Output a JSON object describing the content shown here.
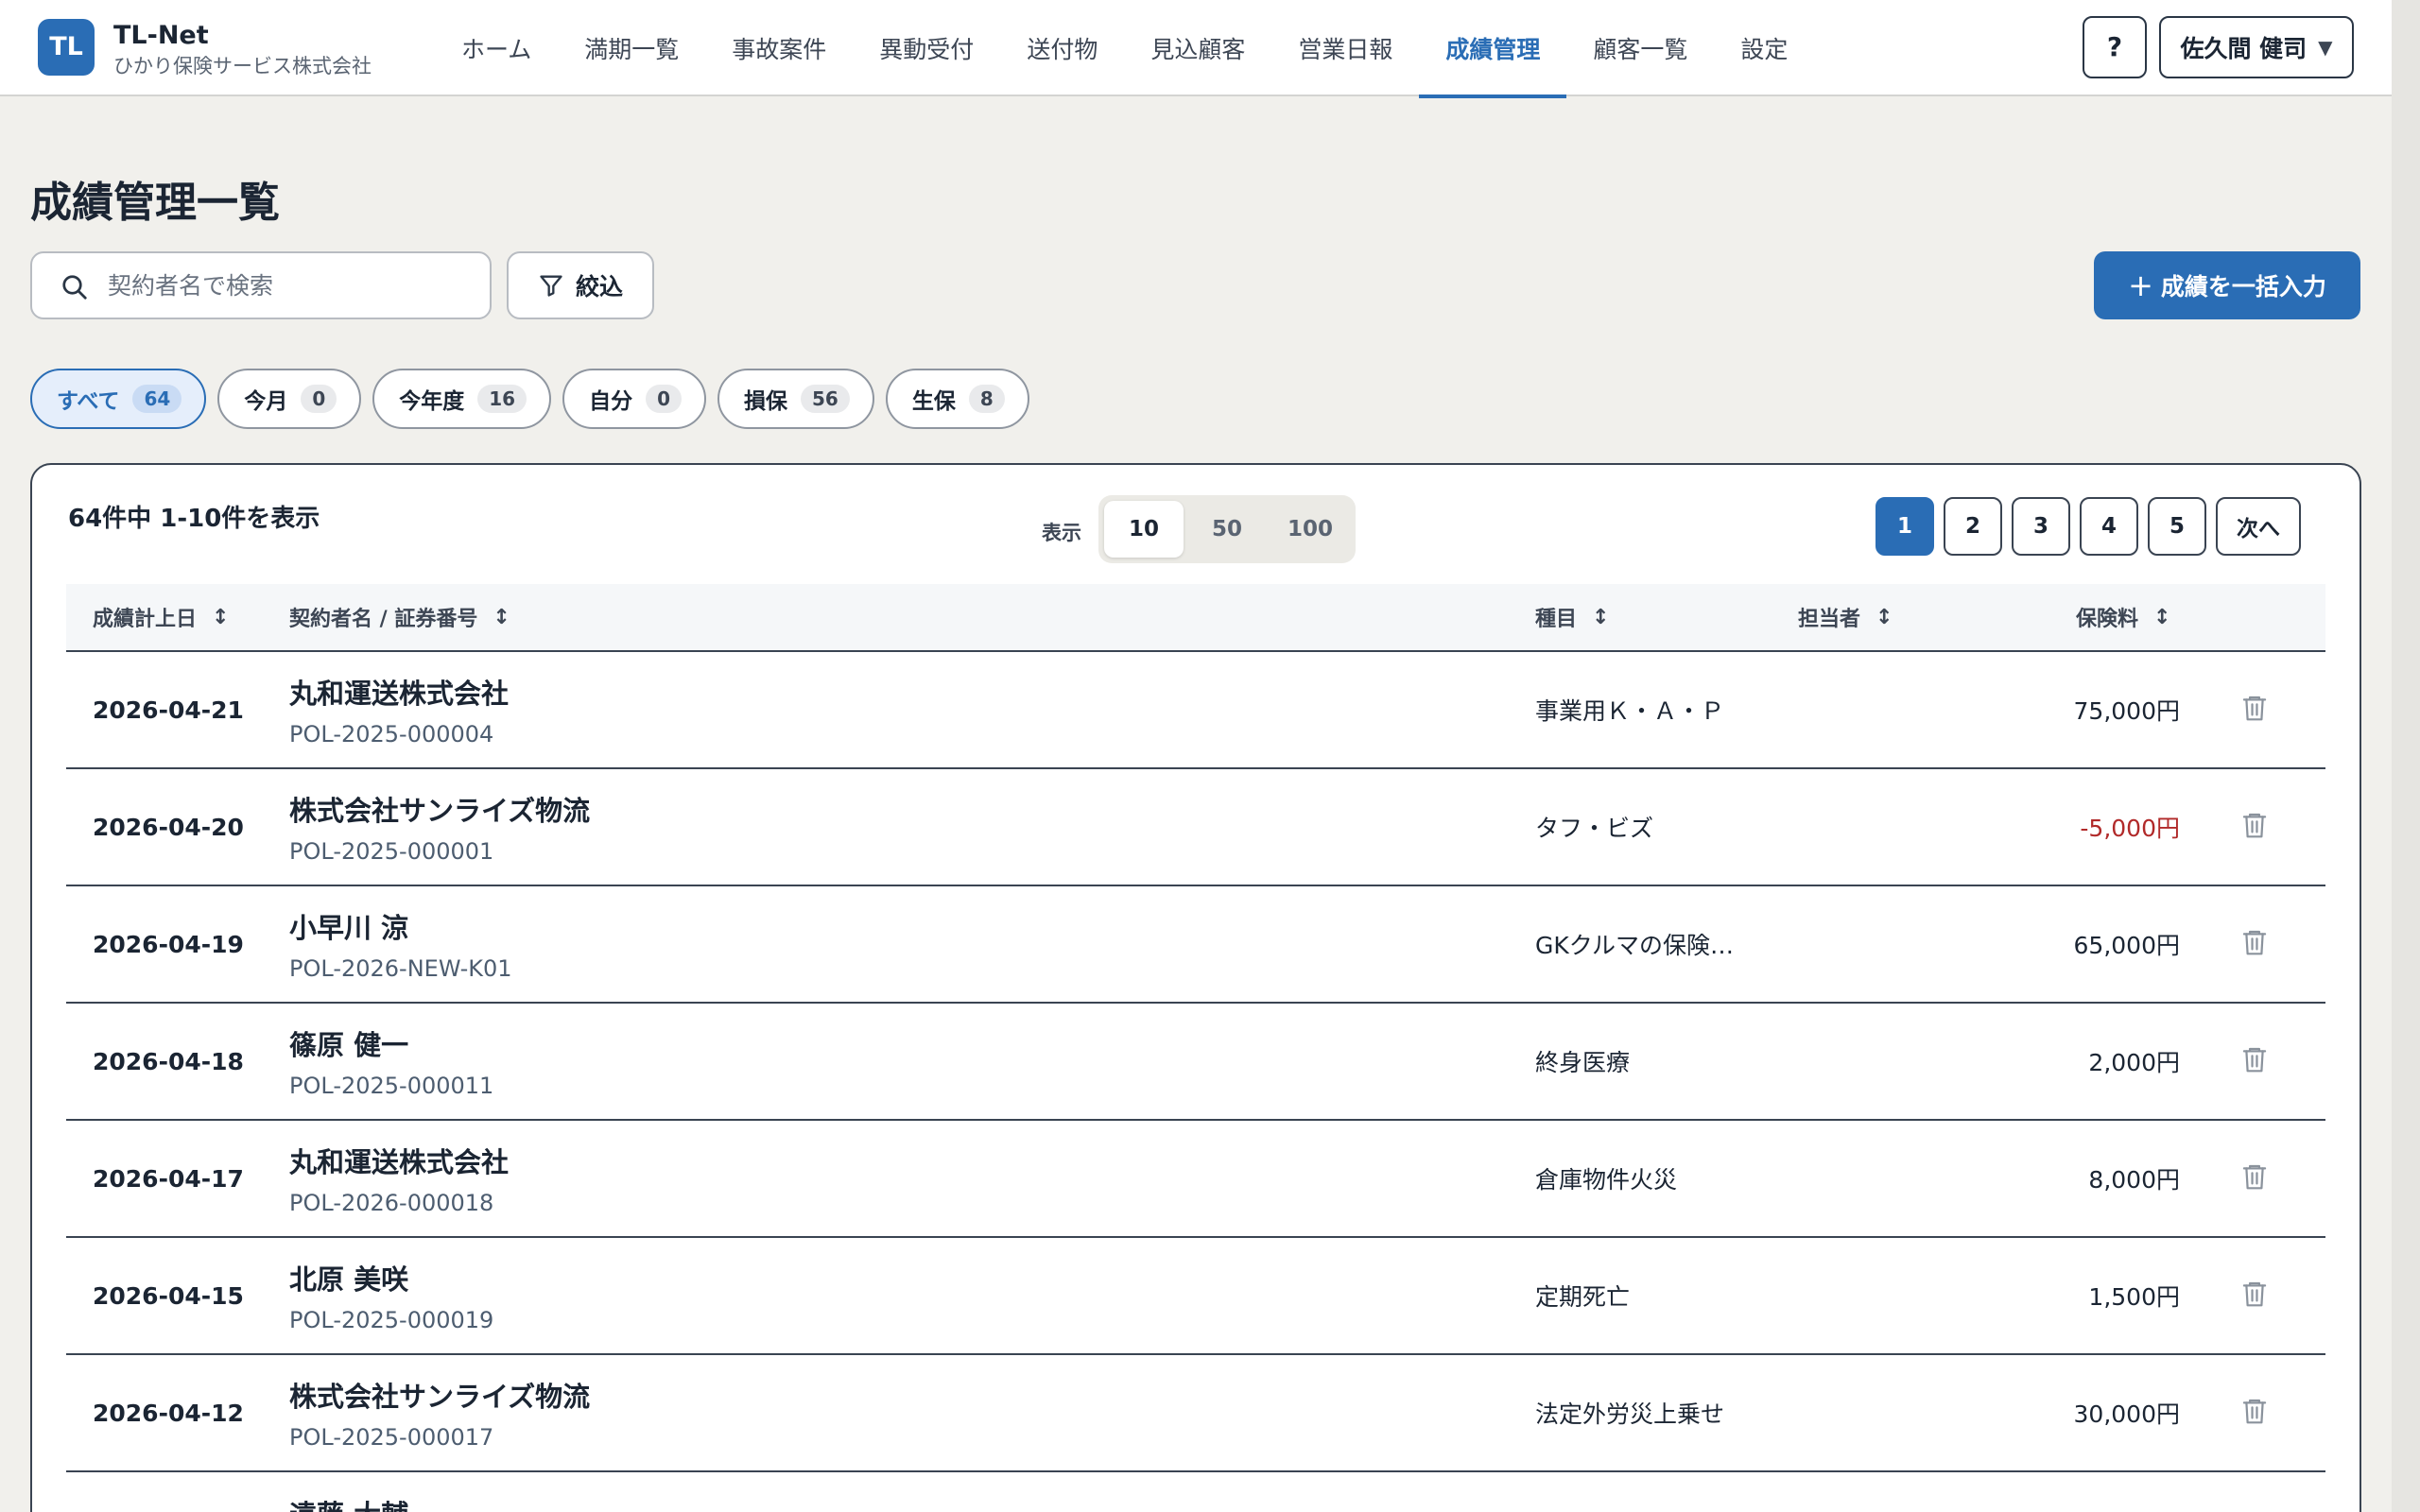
{
  "app": {
    "logo": "TL",
    "name": "TL-Net",
    "company": "ひかり保険サービス株式会社"
  },
  "nav": [
    {
      "label": "ホーム",
      "active": false
    },
    {
      "label": "満期一覧",
      "active": false
    },
    {
      "label": "事故案件",
      "active": false
    },
    {
      "label": "異動受付",
      "active": false
    },
    {
      "label": "送付物",
      "active": false
    },
    {
      "label": "見込顧客",
      "active": false
    },
    {
      "label": "営業日報",
      "active": false
    },
    {
      "label": "成績管理",
      "active": true
    },
    {
      "label": "顧客一覧",
      "active": false
    },
    {
      "label": "設定",
      "active": false
    }
  ],
  "header": {
    "help": "?",
    "user": "佐久間 健司"
  },
  "page": {
    "title": "成績管理一覧",
    "search_placeholder": "契約者名で検索",
    "filter_label": "絞込",
    "bulk_label": "成績を一括入力"
  },
  "chips": [
    {
      "label": "すべて",
      "count": "64",
      "active": true
    },
    {
      "label": "今月",
      "count": "0",
      "active": false
    },
    {
      "label": "今年度",
      "count": "16",
      "active": false
    },
    {
      "label": "自分",
      "count": "0",
      "active": false
    },
    {
      "label": "損保",
      "count": "56",
      "active": false
    },
    {
      "label": "生保",
      "count": "8",
      "active": false
    }
  ],
  "list": {
    "range_text": "64件中 1-10件を表示",
    "per_page_label": "表示",
    "per_page_options": [
      "10",
      "50",
      "100"
    ],
    "per_page_selected": "10",
    "pages": [
      "1",
      "2",
      "3",
      "4",
      "5"
    ],
    "current_page": "1",
    "next_label": "次へ"
  },
  "table": {
    "columns": {
      "date": "成績計上日",
      "name": "契約者名 / 証券番号",
      "type": "種目",
      "owner": "担当者",
      "premium": "保険料"
    },
    "rows": [
      {
        "date": "2026-04-21",
        "name": "丸和運送株式会社",
        "policy": "POL-2025-000004",
        "type": "事業用Ｋ・Ａ・Ｐ",
        "premium": "75,000円",
        "negative": false
      },
      {
        "date": "2026-04-20",
        "name": "株式会社サンライズ物流",
        "policy": "POL-2025-000001",
        "type": "タフ・ビズ",
        "premium": "-5,000円",
        "negative": true
      },
      {
        "date": "2026-04-19",
        "name": "小早川 涼",
        "policy": "POL-2026-NEW-K01",
        "type": "GKクルマの保険…",
        "premium": "65,000円",
        "negative": false
      },
      {
        "date": "2026-04-18",
        "name": "篠原 健一",
        "policy": "POL-2025-000011",
        "type": "終身医療",
        "premium": "2,000円",
        "negative": false
      },
      {
        "date": "2026-04-17",
        "name": "丸和運送株式会社",
        "policy": "POL-2026-000018",
        "type": "倉庫物件火災",
        "premium": "8,000円",
        "negative": false
      },
      {
        "date": "2026-04-15",
        "name": "北原 美咲",
        "policy": "POL-2025-000019",
        "type": "定期死亡",
        "premium": "1,500円",
        "negative": false
      },
      {
        "date": "2026-04-12",
        "name": "株式会社サンライズ物流",
        "policy": "POL-2025-000017",
        "type": "法定外労災上乗せ",
        "premium": "30,000円",
        "negative": false
      }
    ],
    "partial_row_name": "遠藤 大輔"
  },
  "colors": {
    "accent": "#2a6db5",
    "negative": "#b12a2a",
    "background": "#f1f0ec"
  }
}
